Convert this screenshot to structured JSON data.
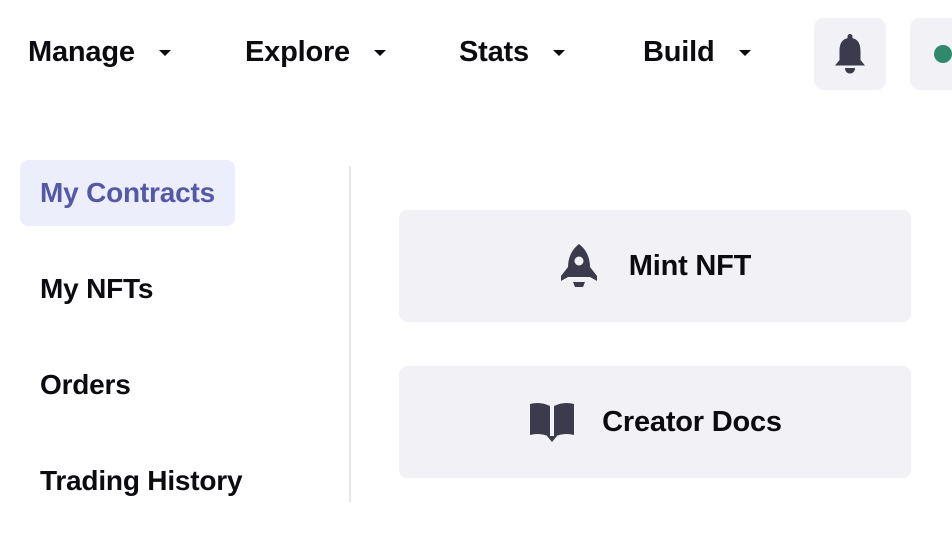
{
  "nav": {
    "items": [
      {
        "label": "Manage"
      },
      {
        "label": "Explore"
      },
      {
        "label": "Stats"
      },
      {
        "label": "Build"
      }
    ],
    "notifications_icon": "bell-icon"
  },
  "sidebar": {
    "items": [
      {
        "label": "My Contracts",
        "active": true
      },
      {
        "label": "My NFTs"
      },
      {
        "label": "Orders"
      },
      {
        "label": "Trading History"
      }
    ]
  },
  "actions": [
    {
      "label": "Mint NFT",
      "icon": "rocket-icon"
    },
    {
      "label": "Creator Docs",
      "icon": "book-icon"
    }
  ],
  "colors": {
    "accent": "#5559a5",
    "active_bg": "#eceefb",
    "card_bg": "#f2f2f6",
    "icon": "#3b3b4d",
    "status": "#2f8a6b"
  }
}
